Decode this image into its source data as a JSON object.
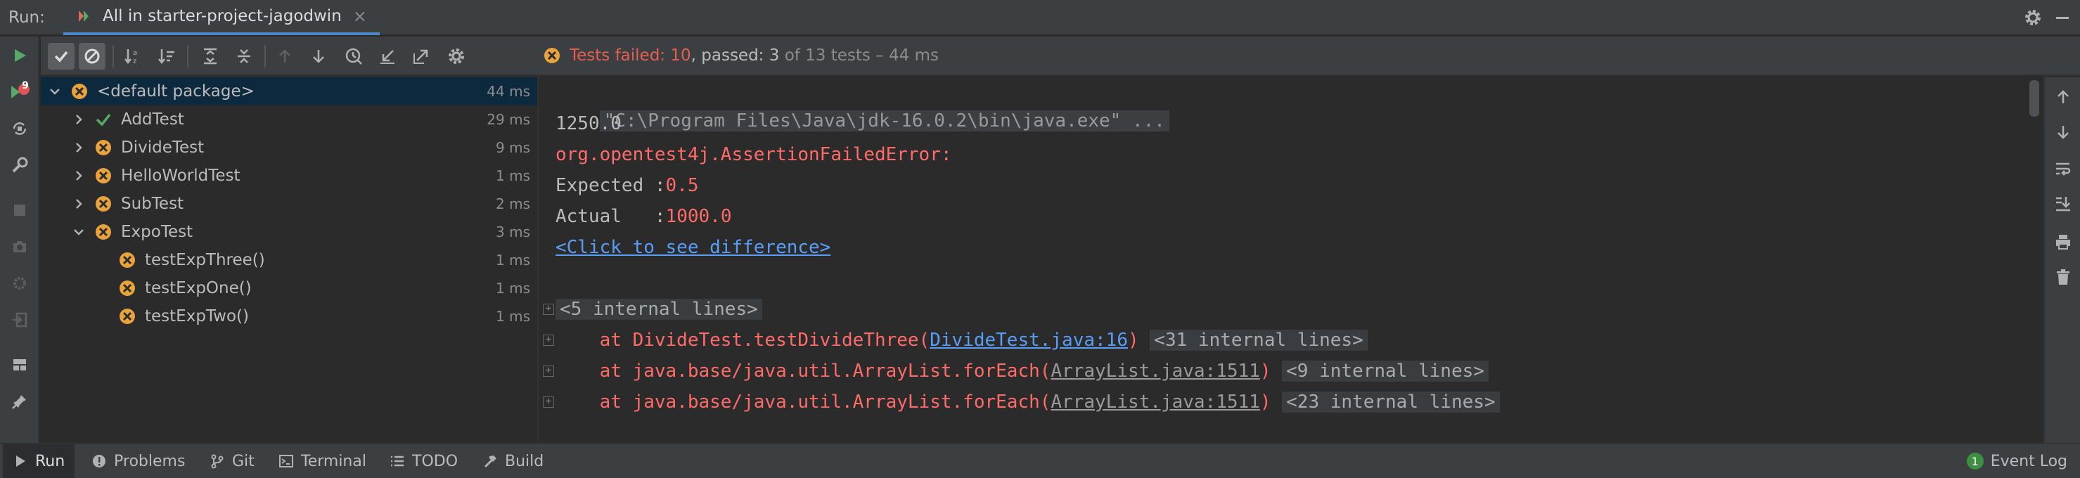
{
  "header": {
    "run_label": "Run:",
    "tab_title": "All in starter-project-jagodwin",
    "tab_close": "×"
  },
  "status": {
    "failed_text": "Tests failed: 10",
    "sep": ",",
    "passed_text": "passed: 3",
    "rest_text": "of 13 tests – 44 ms"
  },
  "tree": {
    "rows": [
      {
        "label": "<default package>",
        "duration": "44 ms",
        "status": "failed",
        "expanded": true
      },
      {
        "label": "AddTest",
        "duration": "29 ms",
        "status": "passed",
        "expanded": false
      },
      {
        "label": "DivideTest",
        "duration": "9 ms",
        "status": "failed",
        "expanded": false
      },
      {
        "label": "HelloWorldTest",
        "duration": "1 ms",
        "status": "failed",
        "expanded": false
      },
      {
        "label": "SubTest",
        "duration": "2 ms",
        "status": "failed",
        "expanded": false
      },
      {
        "label": "ExpoTest",
        "duration": "3 ms",
        "status": "failed",
        "expanded": true
      },
      {
        "label": "testExpThree()",
        "duration": "1 ms",
        "status": "failed"
      },
      {
        "label": "testExpOne()",
        "duration": "1 ms",
        "status": "failed"
      },
      {
        "label": "testExpTwo()",
        "duration": "1 ms",
        "status": "failed"
      }
    ]
  },
  "console": {
    "cmd": "\"C:\\Program Files\\Java\\jdk-16.0.2\\bin\\java.exe\" ...",
    "out1": "1250.0",
    "error_class": "org.opentest4j.AssertionFailedError:",
    "expected_label": "Expected :",
    "expected_value": "0.5",
    "actual_label": "Actual   :",
    "actual_value": "1000.0",
    "diff_link": "<Click to see difference>",
    "fold1": "<5 internal lines>",
    "st1_prefix": "    at DivideTest.testDivideThree(",
    "st1_link": "DivideTest.java:16",
    "st1_suffix": ")",
    "st1_fold": "<31 internal lines>",
    "st2_prefix": "    at java.base/java.util.ArrayList.forEach(",
    "st2_link": "ArrayList.java:1511",
    "st2_suffix": ")",
    "st2_fold": "<9 internal lines>",
    "st3_prefix": "    at java.base/java.util.ArrayList.forEach(",
    "st3_link": "ArrayList.java:1511",
    "st3_suffix": ")",
    "st3_fold": "<23 internal lines>",
    "fold_glyph": "+"
  },
  "bottom_bar": {
    "run": "Run",
    "problems": "Problems",
    "git": "Git",
    "terminal": "Terminal",
    "todo": "TODO",
    "build": "Build",
    "event_log": "Event Log",
    "event_count": "1"
  },
  "left_strip": {
    "rerun_failed_badge": "9"
  },
  "colors": {
    "failed": "#e8a33d",
    "passed": "#59a869",
    "error_text": "#ff6b68",
    "accent": "#4a88c7"
  }
}
